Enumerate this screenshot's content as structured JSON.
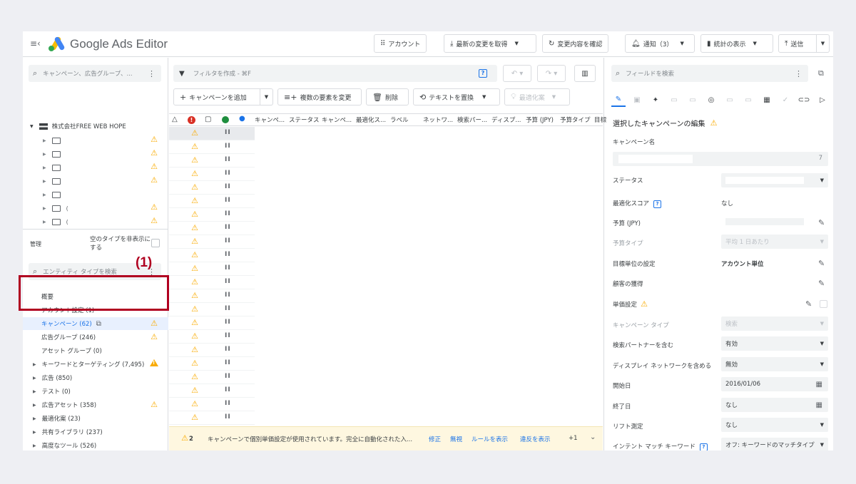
{
  "app": {
    "title": "Google Ads Editor"
  },
  "toolbar": {
    "account": "アカウント",
    "get_changes": "最新の変更を取得",
    "review_changes": "変更内容を確認",
    "notifications": "通知（3）",
    "stats": "統計の表示",
    "post": "送信"
  },
  "left": {
    "search_placeholder": "キャンペーン、広告グループ、...",
    "account_name": "株式会社FREE WEB HOPE",
    "tree_items": [
      {
        "label": "",
        "warn": true
      },
      {
        "label": "",
        "warn": true
      },
      {
        "label": "",
        "warn": true
      },
      {
        "label": "",
        "warn": true
      },
      {
        "label": "",
        "warn": false
      },
      {
        "label": "(",
        "warn": true
      },
      {
        "label": "(",
        "warn": true
      }
    ],
    "manage_label": "管理",
    "hide_empty_label": "空のタイプを非表示にする",
    "entity_search_placeholder": "エンティティ タイプを検索",
    "annotation": "(1)",
    "nav": [
      {
        "label": "概要",
        "expandable": false
      },
      {
        "label": "アカウント設定 (1)",
        "expandable": false
      },
      {
        "label": "キャンペーン (62)",
        "expandable": false,
        "selected": true,
        "warn": true
      },
      {
        "label": "広告グループ (246)",
        "expandable": false,
        "warn": true
      },
      {
        "label": "アセット グループ (0)",
        "expandable": false
      },
      {
        "label": "キーワードとターゲティング (7,495)",
        "expandable": true,
        "warn": true
      },
      {
        "label": "広告 (850)",
        "expandable": true
      },
      {
        "label": "テスト (0)",
        "expandable": true
      },
      {
        "label": "広告アセット (358)",
        "expandable": true,
        "warn": true
      },
      {
        "label": "最適化案 (23)",
        "expandable": true
      },
      {
        "label": "共有ライブラリ (237)",
        "expandable": true
      },
      {
        "label": "高度なツール (526)",
        "expandable": true
      }
    ]
  },
  "center": {
    "filter_placeholder": "フィルタを作成 - ⌘F",
    "actions": {
      "add_campaign": "キャンペーンを追加",
      "edit_multiple": "複数の要素を変更",
      "delete": "削除",
      "replace_text": "テキストを置換",
      "recommendations": "最適化案"
    },
    "columns": [
      "キャンペ...",
      "ステータス",
      "キャンペ...",
      "最適化ス...",
      "ラベル",
      "ネットワ...",
      "検索パー...",
      "ディスプ...",
      "予算 (JPY)",
      "予算タイプ",
      "目標"
    ],
    "row_count": 22,
    "notice": {
      "count": "2",
      "message": "キャンペーンで個別単価設定が使用されています。完全に自動化された入...",
      "fix": "修正",
      "ignore": "無視",
      "show_rules": "ルールを表示",
      "show_violations": "違反を表示",
      "more": "+1"
    }
  },
  "right": {
    "search_placeholder": "フィールドを検索",
    "panel_title": "選択したキャンペーンの編集",
    "fields": {
      "campaign_name_label": "キャンペーン名",
      "campaign_name_count": "7",
      "status_label": "ステータス",
      "opt_score_label": "最適化スコア",
      "opt_score_value": "なし",
      "budget_label": "予算 (JPY)",
      "budget_type_label": "予算タイプ",
      "budget_type_value": "平均 1 日あたり",
      "goal_setting_label": "目標単位の設定",
      "goal_setting_value": "アカウント単位",
      "customer_acq_label": "顧客の獲得",
      "bid_setting_label": "単価設定",
      "campaign_type_label": "キャンペーン タイプ",
      "campaign_type_value": "検索",
      "search_partners_label": "検索パートナーを含む",
      "search_partners_value": "有効",
      "display_network_label": "ディスプレイ ネットワークを含める",
      "display_network_value": "無効",
      "start_date_label": "開始日",
      "start_date_value": "2016/01/06",
      "end_date_label": "終了日",
      "end_date_value": "なし",
      "lift_label": "リフト測定",
      "lift_value": "なし",
      "intent_label": "インテント マッチ キーワード",
      "intent_value": "オフ: キーワードのマッチタイプ"
    }
  },
  "colors": {
    "accent": "#1a73e8",
    "warn": "#f9ab00",
    "annotation": "#b00020",
    "selected_bg": "#e8f0fe"
  }
}
